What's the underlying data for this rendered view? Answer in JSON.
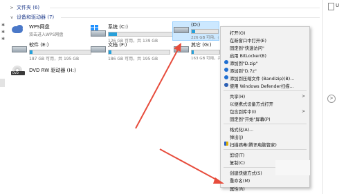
{
  "sections": {
    "folders": {
      "label": "文件夹 (6)"
    },
    "devices": {
      "label": "设备和驱动器 (7)"
    }
  },
  "drives": [
    {
      "name": "WPS网盘",
      "free": "双击进入WPS网盘",
      "icon": "wps-cloud-icon"
    },
    {
      "name": "系统 (C:)",
      "free": "126 GB 可用，共 139 GB",
      "used_fraction": 0.1
    },
    {
      "name": "(D:)",
      "free": "226 GB 可用，共 ... GB",
      "used_fraction": 0.12
    },
    {
      "name": "软件 (E:)",
      "free": "187 GB 可用，共 195 GB",
      "used_fraction": 0.05
    },
    {
      "name": "文档 (F:)",
      "free": "186 GB 可用，共 195 GB",
      "used_fraction": 0.05
    },
    {
      "name": "其它 (G:)",
      "free": "163 GB 可用，共 ... GB",
      "used_fraction": 0.08
    },
    {
      "name": "DVD RW 驱动器 (H:)",
      "icon": "dvd-drive-icon"
    }
  ],
  "right_pane": {
    "u_char": "U"
  },
  "context_menu": {
    "items": [
      {
        "label": "打开(O)"
      },
      {
        "label": "在新窗口中打开(E)"
      },
      {
        "label": "固定到\"快速访问\""
      },
      {
        "label": "启用 BitLocker(B)"
      },
      {
        "label": "添加到\"D.zip\"",
        "icon": "bandizip-icon"
      },
      {
        "label": "添加到\"D.7z\"",
        "icon": "bandizip-icon"
      },
      {
        "label": "添加到压缩文件 (Bandizip)(B)...",
        "icon": "bandizip-icon"
      },
      {
        "label": "使用 Windows Defender扫描...",
        "icon": "defender-icon"
      },
      {
        "label": "共享(H)",
        "submenu": true
      },
      {
        "label": "以便携式设备方式打开"
      },
      {
        "label": "包含到库中(I)",
        "submenu": true
      },
      {
        "label": "固定到\"开始\"屏幕(P)"
      },
      {
        "label": "格式化(A)..."
      },
      {
        "label": "弹出(J)"
      },
      {
        "label": "扫描病毒(腾讯电脑管家)",
        "icon": "tencent-shield-icon"
      },
      {
        "label": "剪切(T)"
      },
      {
        "label": "复制(C)"
      },
      {
        "label": "创建快捷方式(S)"
      },
      {
        "label": "重命名(M)"
      },
      {
        "label": "属性(R)"
      }
    ]
  },
  "colors": {
    "accent_blue": "#26a0da",
    "selection": "#cce8ff",
    "arrow_red": "#e74c3c",
    "section_header": "#1e3a8a"
  }
}
